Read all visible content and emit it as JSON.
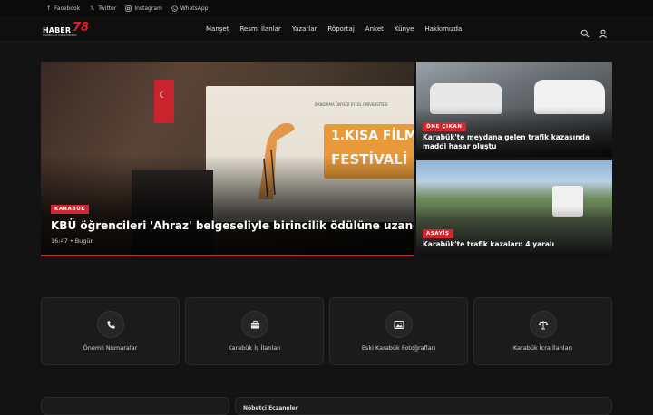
{
  "topbar": {
    "social": [
      {
        "label": "Facebook",
        "icon": "facebook-icon"
      },
      {
        "label": "Twitter",
        "icon": "twitter-x-icon"
      },
      {
        "label": "Instagram",
        "icon": "instagram-icon"
      },
      {
        "label": "WhatsApp",
        "icon": "whatsapp-icon"
      }
    ]
  },
  "brand": {
    "word": "HABER",
    "number": "78",
    "tagline": "KARABÜK'ÜN HABER MERKEZİ"
  },
  "nav": {
    "items": [
      "Manşet",
      "Resmi İlanlar",
      "Yazarlar",
      "Röportaj",
      "Anket",
      "Künye",
      "Hakkımızda"
    ],
    "icons": [
      "search-icon",
      "user-icon"
    ]
  },
  "hero": {
    "category": "KARABÜK",
    "title": "KBÜ öğrencileri 'Ahraz' belgeseliyle birincilik ödülüne uzandı",
    "time": "16:47",
    "day": "Bugün",
    "screen_heading": "BANDIRMA ONYEDİ EYLÜL ÜNİVERSİTESİ",
    "screen_line1": "1.KISA FİLM",
    "screen_line2": "FESTİVALİ"
  },
  "side": [
    {
      "category": "ÖNE ÇIKAN",
      "title": "Karabük'te meydana gelen trafik kazasında maddi hasar oluştu"
    },
    {
      "category": "ASAYİŞ",
      "title": "Karabük'te trafik kazaları: 4 yaralı"
    }
  ],
  "quick_links": [
    {
      "label": "Önemli Numaralar",
      "icon": "phone-icon"
    },
    {
      "label": "Karabük İş İlanları",
      "icon": "briefcase-icon"
    },
    {
      "label": "Eski Karabük Fotoğrafları",
      "icon": "photo-icon"
    },
    {
      "label": "Karabük İcra İlanları",
      "icon": "scales-icon"
    }
  ],
  "bottom": {
    "right_label": "Nöbetçi Eczaneler"
  },
  "colors": {
    "accent": "#d3262e",
    "background": "#131313",
    "card": "#1b1b1b"
  }
}
